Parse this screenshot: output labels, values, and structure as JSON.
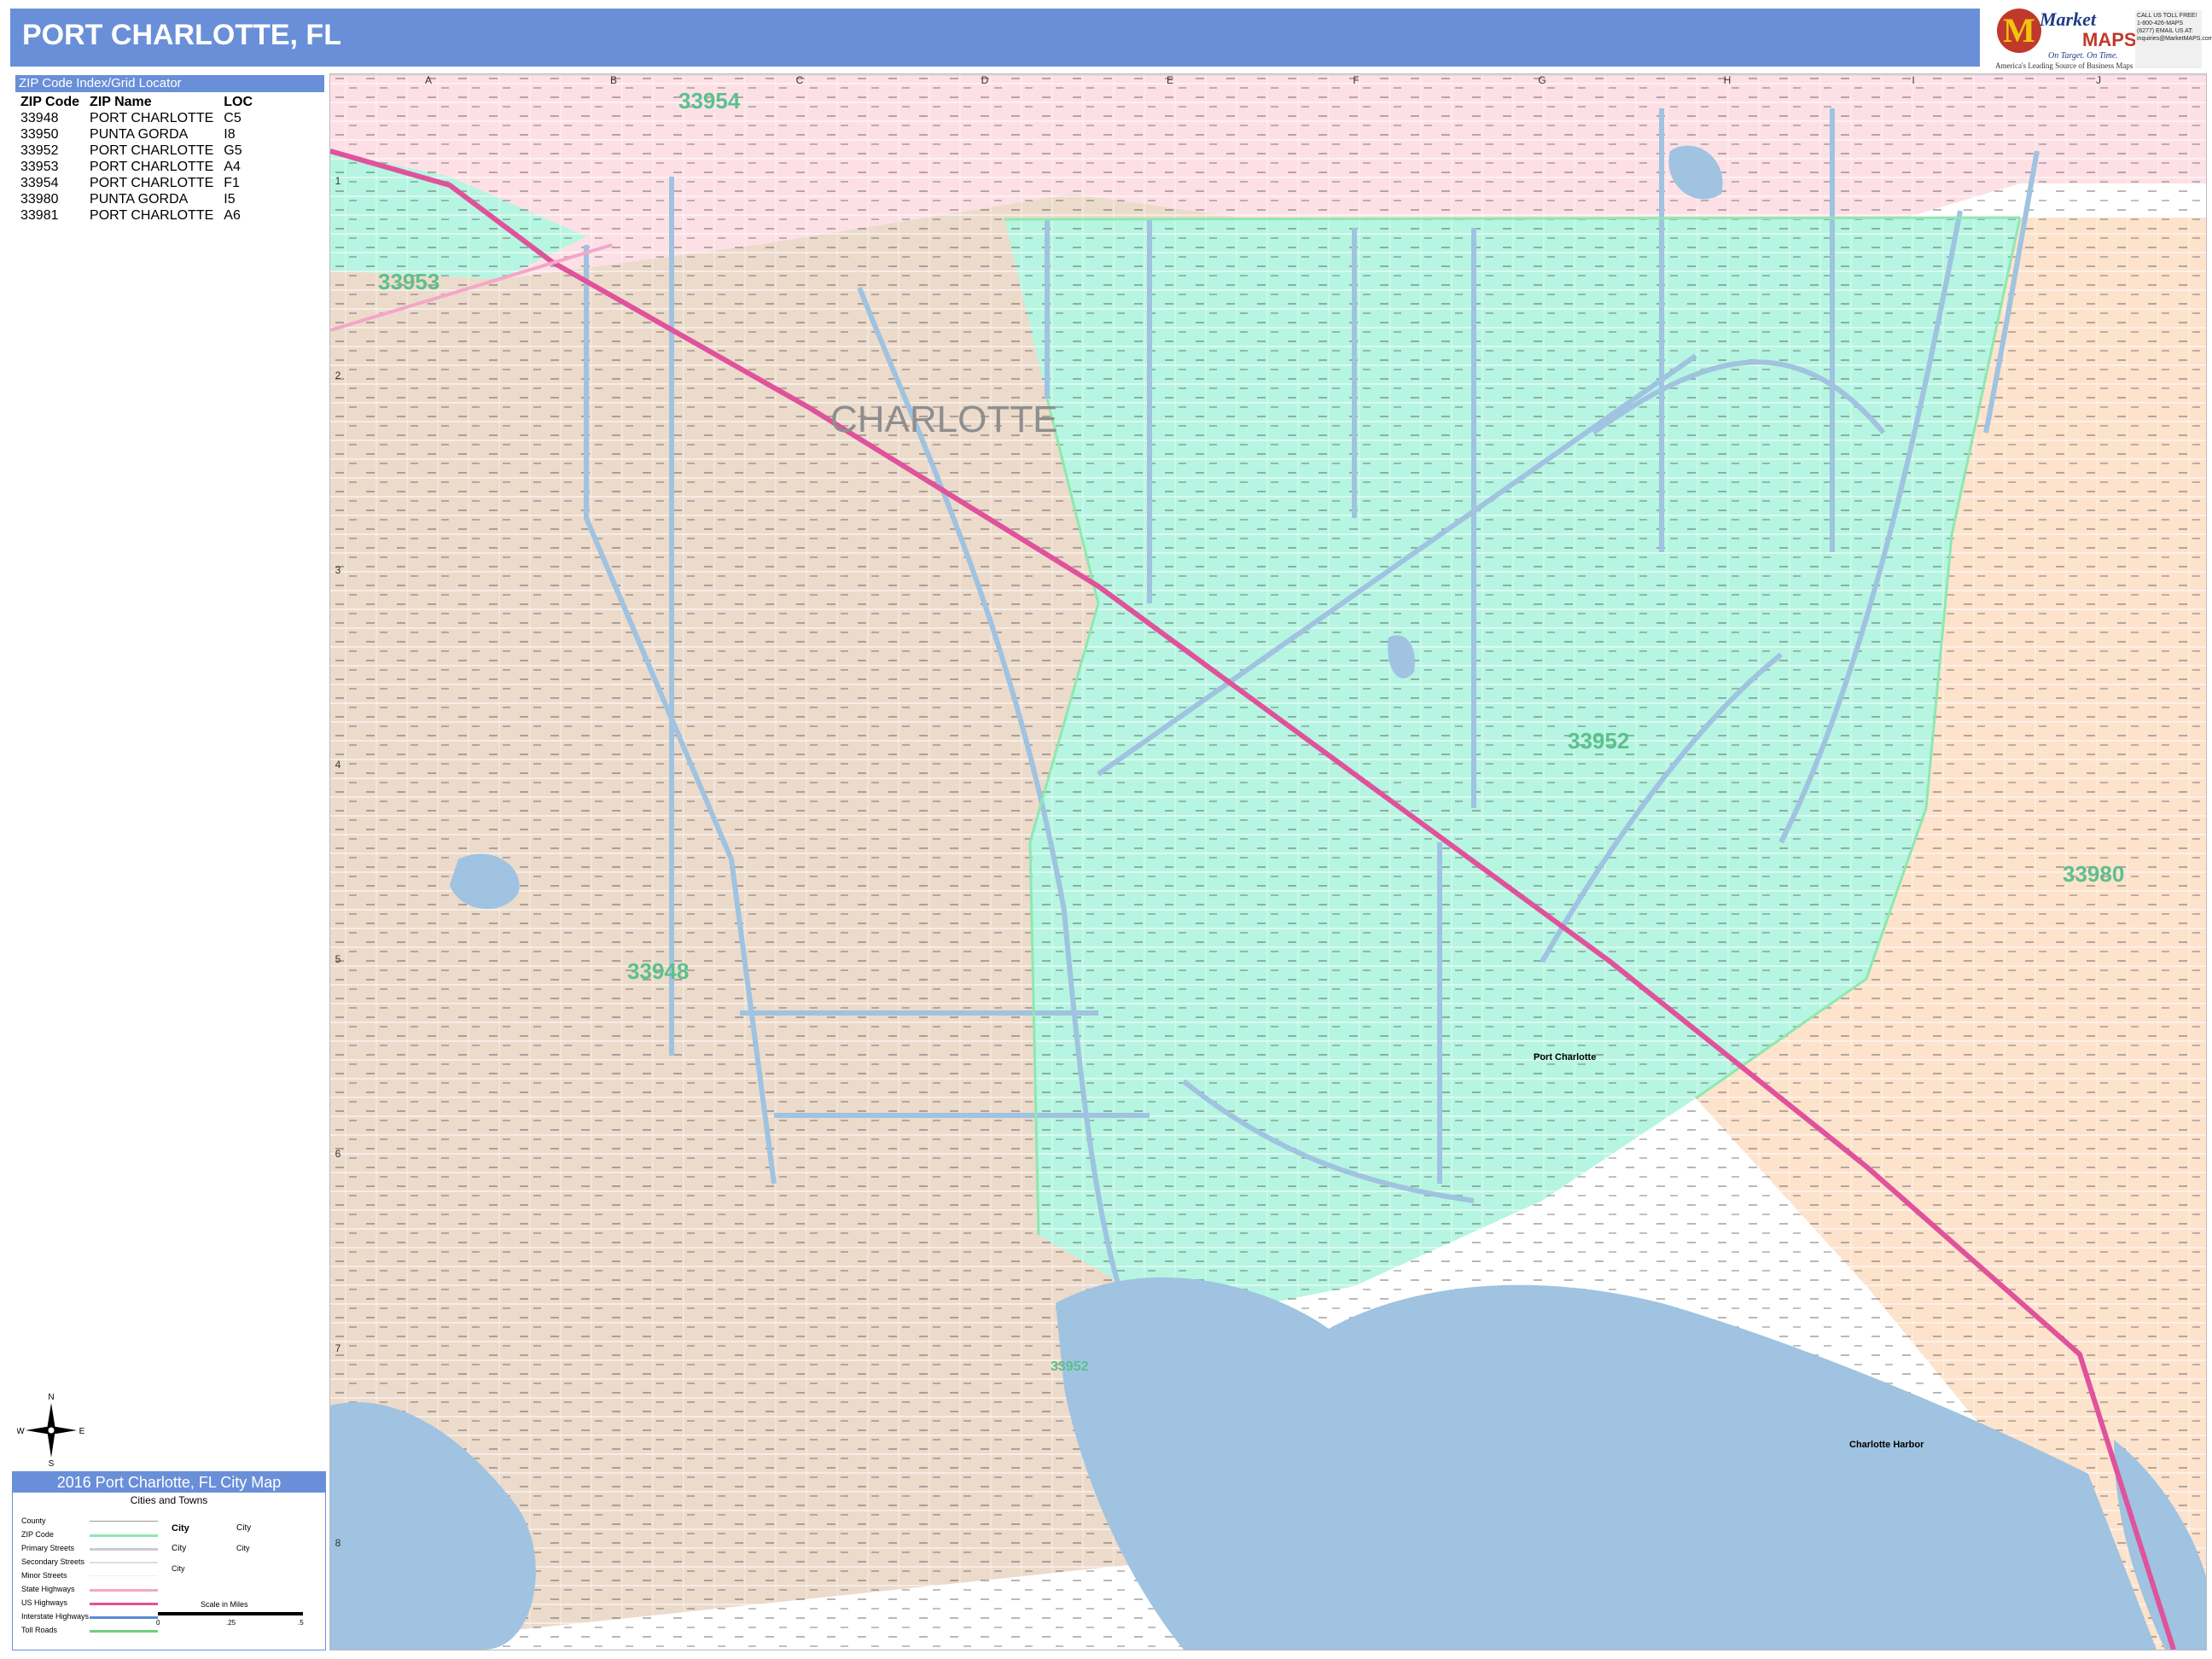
{
  "title": "PORT CHARLOTTE, FL",
  "logo": {
    "brand_top": "Market",
    "brand_bottom": "MAPS",
    "tagline": "On Target.  On Time.",
    "subtitle": "America's Leading Source of Business Maps",
    "contact": "CALL US TOLL FREE! 1-800-426-MAPS (6277) EMAIL US AT: inquiries@MarketMAPS.com"
  },
  "zip_index": {
    "header": "ZIP Code Index/Grid Locator",
    "columns": [
      "ZIP Code",
      "ZIP Name",
      "LOC"
    ],
    "rows": [
      [
        "33948",
        "PORT CHARLOTTE",
        "C5"
      ],
      [
        "33950",
        "PUNTA GORDA",
        "I8"
      ],
      [
        "33952",
        "PORT CHARLOTTE",
        "G5"
      ],
      [
        "33953",
        "PORT CHARLOTTE",
        "A4"
      ],
      [
        "33954",
        "PORT CHARLOTTE",
        "F1"
      ],
      [
        "33980",
        "PUNTA GORDA",
        "I5"
      ],
      [
        "33981",
        "PORT CHARLOTTE",
        "A6"
      ]
    ]
  },
  "legend": {
    "title": "2016 Port Charlotte, FL City Map",
    "subtitle": "Cities and Towns",
    "items": [
      "County",
      "ZIP Code",
      "Primary Streets",
      "Secondary Streets",
      "Minor Streets",
      "State Highways",
      "US Highways",
      "Interstate Highways",
      "Toll Roads"
    ],
    "city_label": "City",
    "scale_label": "Scale in Miles",
    "scale_ticks": [
      "0",
      ".25",
      ".5"
    ]
  },
  "map": {
    "grid_columns": [
      "A",
      "B",
      "C",
      "D",
      "E",
      "F",
      "G",
      "H",
      "I",
      "J"
    ],
    "grid_rows": [
      "1",
      "2",
      "3",
      "4",
      "5",
      "6",
      "7",
      "8"
    ],
    "zip_labels": [
      "33954",
      "33953",
      "33952",
      "33948",
      "33980",
      "33952"
    ],
    "city_label": "CHARLOTTE",
    "places": [
      "Port Charlotte",
      "Charlotte Harbor"
    ],
    "colors": {
      "zip_33954": "#fde0e6",
      "zip_33948": "#ecdacb",
      "zip_33952": "#b6f5e1",
      "zip_33980": "#fde2cc",
      "water": "#9fc3e0",
      "highway": "#e0529b",
      "zip_label": "#5cc08e",
      "title_bar": "#6a8fd9"
    }
  }
}
